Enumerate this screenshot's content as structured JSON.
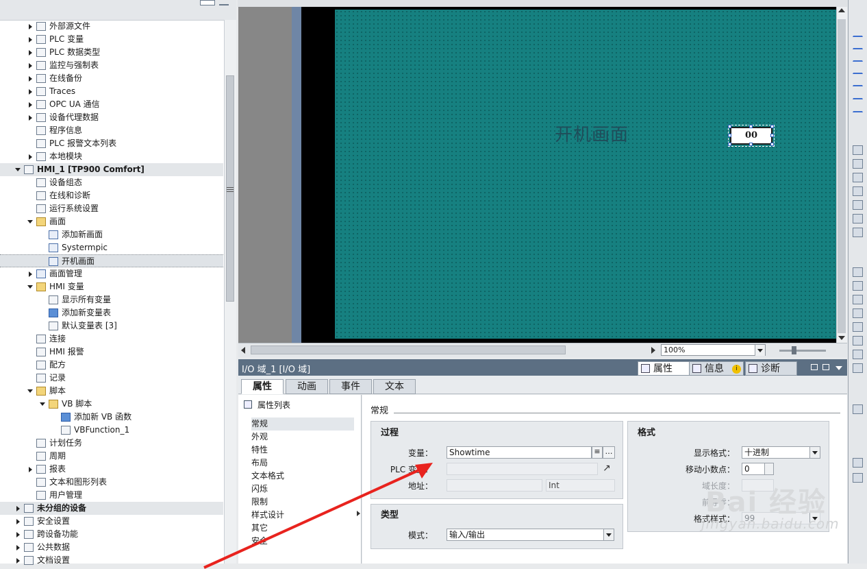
{
  "tree": {
    "items": [
      {
        "label": "外部源文件",
        "depth": 2,
        "arrow": "collapsed",
        "icon": "external-source-icon"
      },
      {
        "label": "PLC 变量",
        "depth": 2,
        "arrow": "collapsed",
        "icon": "plc-tag-icon"
      },
      {
        "label": "PLC 数据类型",
        "depth": 2,
        "arrow": "collapsed",
        "icon": "plc-datatype-icon"
      },
      {
        "label": "监控与强制表",
        "depth": 2,
        "arrow": "collapsed",
        "icon": "watch-table-icon"
      },
      {
        "label": "在线备份",
        "depth": 2,
        "arrow": "collapsed",
        "icon": "online-backup-icon"
      },
      {
        "label": "Traces",
        "depth": 2,
        "arrow": "collapsed",
        "icon": "traces-icon"
      },
      {
        "label": "OPC UA 通信",
        "depth": 2,
        "arrow": "collapsed",
        "icon": "opcua-icon"
      },
      {
        "label": "设备代理数据",
        "depth": 2,
        "arrow": "collapsed",
        "icon": "device-proxy-icon"
      },
      {
        "label": "程序信息",
        "depth": 2,
        "arrow": "none",
        "icon": "program-info-icon"
      },
      {
        "label": "PLC 报警文本列表",
        "depth": 2,
        "arrow": "none",
        "icon": "alarm-text-icon"
      },
      {
        "label": "本地模块",
        "depth": 2,
        "arrow": "collapsed",
        "icon": "local-module-icon"
      },
      {
        "label": "HMI_1 [TP900 Comfort]",
        "depth": 1,
        "arrow": "expanded",
        "icon": "hmi-device-icon",
        "bold": true,
        "group": true
      },
      {
        "label": "设备组态",
        "depth": 2,
        "arrow": "none",
        "icon": "device-config-icon"
      },
      {
        "label": "在线和诊断",
        "depth": 2,
        "arrow": "none",
        "icon": "online-diagnostics-icon"
      },
      {
        "label": "运行系统设置",
        "depth": 2,
        "arrow": "none",
        "icon": "runtime-settings-icon"
      },
      {
        "label": "画面",
        "depth": 2,
        "arrow": "expanded",
        "icon": "screens-folder-icon"
      },
      {
        "label": "添加新画面",
        "depth": 3,
        "arrow": "none",
        "icon": "add-screen-icon"
      },
      {
        "label": "Systermpic",
        "depth": 3,
        "arrow": "none",
        "icon": "screen-icon"
      },
      {
        "label": "开机画面",
        "depth": 3,
        "arrow": "none",
        "icon": "start-screen-icon",
        "selected": true
      },
      {
        "label": "画面管理",
        "depth": 2,
        "arrow": "collapsed",
        "icon": "screen-management-icon"
      },
      {
        "label": "HMI 变量",
        "depth": 2,
        "arrow": "expanded",
        "icon": "hmi-tags-folder-icon"
      },
      {
        "label": "显示所有变量",
        "depth": 3,
        "arrow": "none",
        "icon": "show-tags-icon"
      },
      {
        "label": "添加新变量表",
        "depth": 3,
        "arrow": "none",
        "icon": "add-tag-table-icon"
      },
      {
        "label": "默认变量表 [3]",
        "depth": 3,
        "arrow": "none",
        "icon": "tag-table-icon"
      },
      {
        "label": "连接",
        "depth": 2,
        "arrow": "none",
        "icon": "connections-icon"
      },
      {
        "label": "HMI 报警",
        "depth": 2,
        "arrow": "none",
        "icon": "hmi-alarms-icon"
      },
      {
        "label": "配方",
        "depth": 2,
        "arrow": "none",
        "icon": "recipes-icon"
      },
      {
        "label": "记录",
        "depth": 2,
        "arrow": "none",
        "icon": "logs-icon"
      },
      {
        "label": "脚本",
        "depth": 2,
        "arrow": "expanded",
        "icon": "scripts-folder-icon"
      },
      {
        "label": "VB 脚本",
        "depth": 3,
        "arrow": "expanded",
        "icon": "vb-folder-icon"
      },
      {
        "label": "添加新 VB 函数",
        "depth": 4,
        "arrow": "none",
        "icon": "add-vb-function-icon"
      },
      {
        "label": "VBFunction_1",
        "depth": 4,
        "arrow": "none",
        "icon": "vb-function-icon"
      },
      {
        "label": "计划任务",
        "depth": 2,
        "arrow": "none",
        "icon": "scheduled-tasks-icon"
      },
      {
        "label": "周期",
        "depth": 2,
        "arrow": "none",
        "icon": "cycles-icon"
      },
      {
        "label": "报表",
        "depth": 2,
        "arrow": "collapsed",
        "icon": "reports-icon"
      },
      {
        "label": "文本和图形列表",
        "depth": 2,
        "arrow": "none",
        "icon": "text-graphic-lists-icon"
      },
      {
        "label": "用户管理",
        "depth": 2,
        "arrow": "none",
        "icon": "user-admin-icon"
      },
      {
        "label": "未分组的设备",
        "depth": 1,
        "arrow": "collapsed",
        "icon": "ungrouped-devices-icon",
        "bold": true,
        "group": true
      },
      {
        "label": "安全设置",
        "depth": 1,
        "arrow": "collapsed",
        "icon": "security-settings-icon"
      },
      {
        "label": "跨设备功能",
        "depth": 1,
        "arrow": "collapsed",
        "icon": "cross-device-icon"
      },
      {
        "label": "公共数据",
        "depth": 1,
        "arrow": "collapsed",
        "icon": "common-data-icon"
      },
      {
        "label": "文档设置",
        "depth": 1,
        "arrow": "collapsed",
        "icon": "doc-settings-icon"
      }
    ]
  },
  "editor": {
    "screen_title": "开机画面",
    "io_value": "00",
    "zoom": "100%",
    "canvas_color": "#168080"
  },
  "inspector": {
    "title": "I/O 域_1 [I/O 域]",
    "tabs": {
      "properties": "属性",
      "info": "信息",
      "diagnostics": "诊断"
    },
    "prop_tabs": [
      "属性",
      "动画",
      "事件",
      "文本"
    ],
    "prop_list_header": "属性列表",
    "prop_list": [
      "常规",
      "外观",
      "特性",
      "布局",
      "文本格式",
      "闪烁",
      "限制",
      "样式设计",
      "其它",
      "安全"
    ],
    "section": "常规",
    "process": {
      "title": "过程",
      "variable_label": "变量：",
      "variable_value": "Showtime",
      "plc_label": "PLC 变量：",
      "address_label": "地址：",
      "address_type": "Int"
    },
    "type": {
      "title": "类型",
      "mode_label": "模式：",
      "mode_value": "输入/输出"
    },
    "format": {
      "title": "格式",
      "display_label": "显示格式：",
      "display_value": "十进制",
      "decimal_label": "移动小数点：",
      "decimal_value": "0",
      "field_len_label": "域长度：",
      "leading_zero_label": "前导零：",
      "pattern_label": "格式样式：",
      "pattern_value": "99"
    }
  },
  "watermark": {
    "line1": "Bai 经验",
    "line2": "jingyan.baidu.com"
  }
}
